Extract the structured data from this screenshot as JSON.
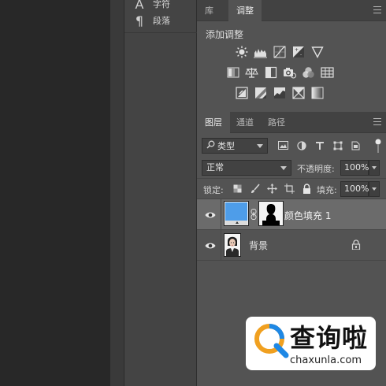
{
  "left_panel": {
    "items": [
      {
        "glyph": "A",
        "label": "字符"
      },
      {
        "glyph": "¶",
        "label": "段落"
      }
    ]
  },
  "adjust_panel": {
    "tabs": [
      {
        "label": "库"
      },
      {
        "label": "调整"
      }
    ],
    "active_tab": "调整",
    "title": "添加调整",
    "icon_rows": [
      [
        "brightness-contrast-icon",
        "levels-icon",
        "curves-icon",
        "exposure-icon",
        "vibrance-icon"
      ],
      [
        "hue-saturation-icon",
        "color-balance-icon",
        "black-white-icon",
        "photo-filter-icon",
        "channel-mixer-icon",
        "color-lookup-icon"
      ],
      [
        "invert-icon",
        "posterize-icon",
        "threshold-icon",
        "selective-color-icon",
        "gradient-map-icon"
      ]
    ]
  },
  "layers_panel": {
    "tabs": [
      {
        "label": "图层"
      },
      {
        "label": "通道"
      },
      {
        "label": "路径"
      }
    ],
    "active_tab": "图层",
    "filter": {
      "icon": "search-icon",
      "value": "类型"
    },
    "blend_mode": "正常",
    "opacity": {
      "label": "不透明度:",
      "value": "100%"
    },
    "lock": {
      "label": "锁定:"
    },
    "fill": {
      "label": "填充:",
      "value": "100%"
    },
    "layers": [
      {
        "name": "颜色填充 1",
        "visible": true,
        "selected": true,
        "fill_color": "#4e9de9"
      },
      {
        "name": "背景",
        "visible": true,
        "selected": false,
        "locked": true
      }
    ]
  },
  "watermark": {
    "title": "查询啦",
    "url": "chaxunla.com"
  },
  "colors": {
    "panel": "#535353",
    "selected_row": "#6b6b6b",
    "fill_swatch": "#4e9de9",
    "canvas": "#282828"
  }
}
